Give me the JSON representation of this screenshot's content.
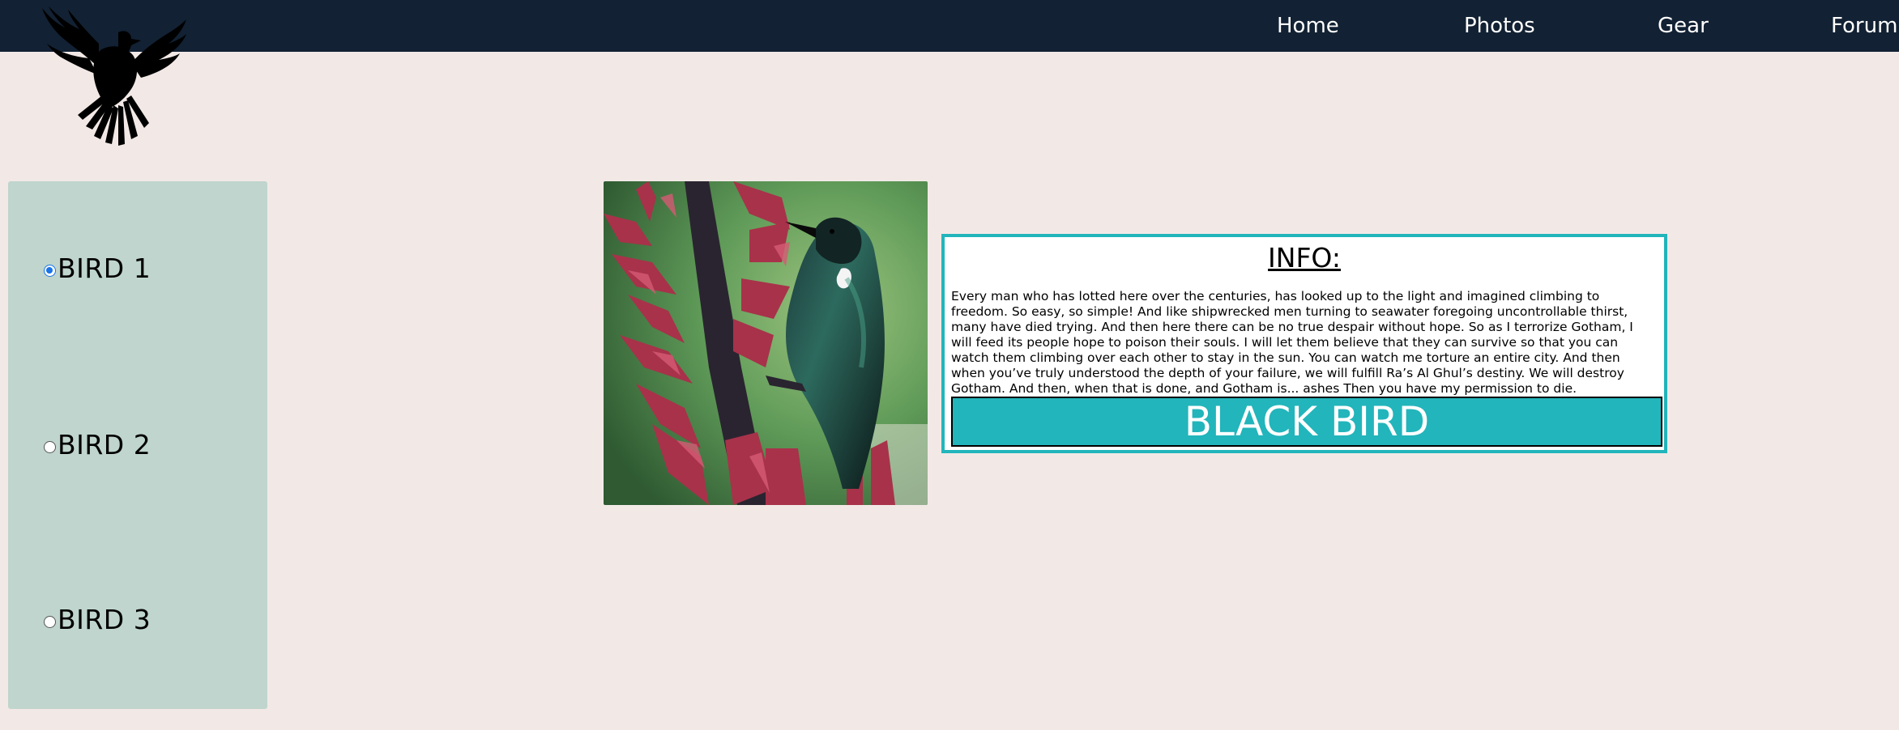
{
  "nav": {
    "items": [
      {
        "label": "Home"
      },
      {
        "label": "Photos"
      },
      {
        "label": "Gear"
      },
      {
        "label": "Forum"
      }
    ]
  },
  "logo": {
    "icon": "bird-silhouette-icon"
  },
  "sidebar": {
    "options": [
      {
        "label": "BIRD 1",
        "checked": true
      },
      {
        "label": "BIRD 2",
        "checked": false
      },
      {
        "label": "BIRD 3",
        "checked": false
      }
    ]
  },
  "info": {
    "title": "INFO:",
    "text": "Every man who has lotted here over the centuries, has looked up to the light and imagined climbing to freedom. So easy, so simple! And like shipwrecked men turning to seawater foregoing uncontrollable thirst, many have died trying. And then here there can be no true despair without hope. So as I terrorize Gotham, I will feed its people hope to poison their souls. I will let them believe that they can survive so that you can watch them climbing over each other to stay in the sun. You can watch me torture an entire city. And then when you’ve truly understood the depth of your failure, we will fulfill Ra’s Al Ghul’s destiny. We will destroy Gotham. And then, when that is done, and Gotham is... ashes Then you have my permission to die.",
    "button_label": "BLACK BIRD"
  },
  "colors": {
    "topbar": "#122133",
    "background": "#f2e9e6",
    "sidebar": "#bfd5cd",
    "accent": "#22b5bb"
  }
}
